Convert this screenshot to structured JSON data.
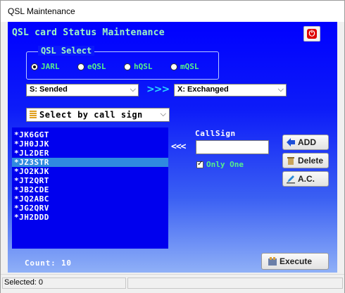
{
  "window": {
    "title": "QSL Maintenance"
  },
  "header": {
    "title": "QSL card Status Maintenance",
    "power_icon": "power-icon"
  },
  "qsl_select": {
    "label": "QSL Select",
    "options": [
      {
        "label": "JARL",
        "selected": true
      },
      {
        "label": "eQSL",
        "selected": false
      },
      {
        "label": "hQSL",
        "selected": false
      },
      {
        "label": "mQSL",
        "selected": false
      }
    ]
  },
  "status_from": {
    "value": "S: Sended"
  },
  "status_arrow": ">>>",
  "status_to": {
    "value": "X: Exchanged"
  },
  "select_mode": {
    "value": "Select by call sign"
  },
  "list": {
    "items": [
      {
        "label": "*JK6GGT",
        "selected": false
      },
      {
        "label": "*JH0JJK",
        "selected": false
      },
      {
        "label": "*JL2DER",
        "selected": false
      },
      {
        "label": "*JZ3STR",
        "selected": true
      },
      {
        "label": "*JO2KJK",
        "selected": false
      },
      {
        "label": "*JT2QRT",
        "selected": false
      },
      {
        "label": "*JB2CDE",
        "selected": false
      },
      {
        "label": "*JQ2ABC",
        "selected": false
      },
      {
        "label": "*JG2QRV",
        "selected": false
      },
      {
        "label": "*JH2DDD",
        "selected": false
      }
    ]
  },
  "callsign": {
    "label": "CallSign",
    "value": "",
    "arrows": "<<<"
  },
  "only_one": {
    "label": "Only One",
    "checked": true
  },
  "buttons": {
    "add": "ADD",
    "delete": "Delete",
    "ac": "A.C.",
    "execute": "Execute"
  },
  "count": {
    "label": "Count: 10"
  },
  "status": {
    "text": "Selected: 0"
  },
  "colors": {
    "accent_green": "#56f08a",
    "header_text": "#9df5c2",
    "selection": "#2f8ae0"
  }
}
